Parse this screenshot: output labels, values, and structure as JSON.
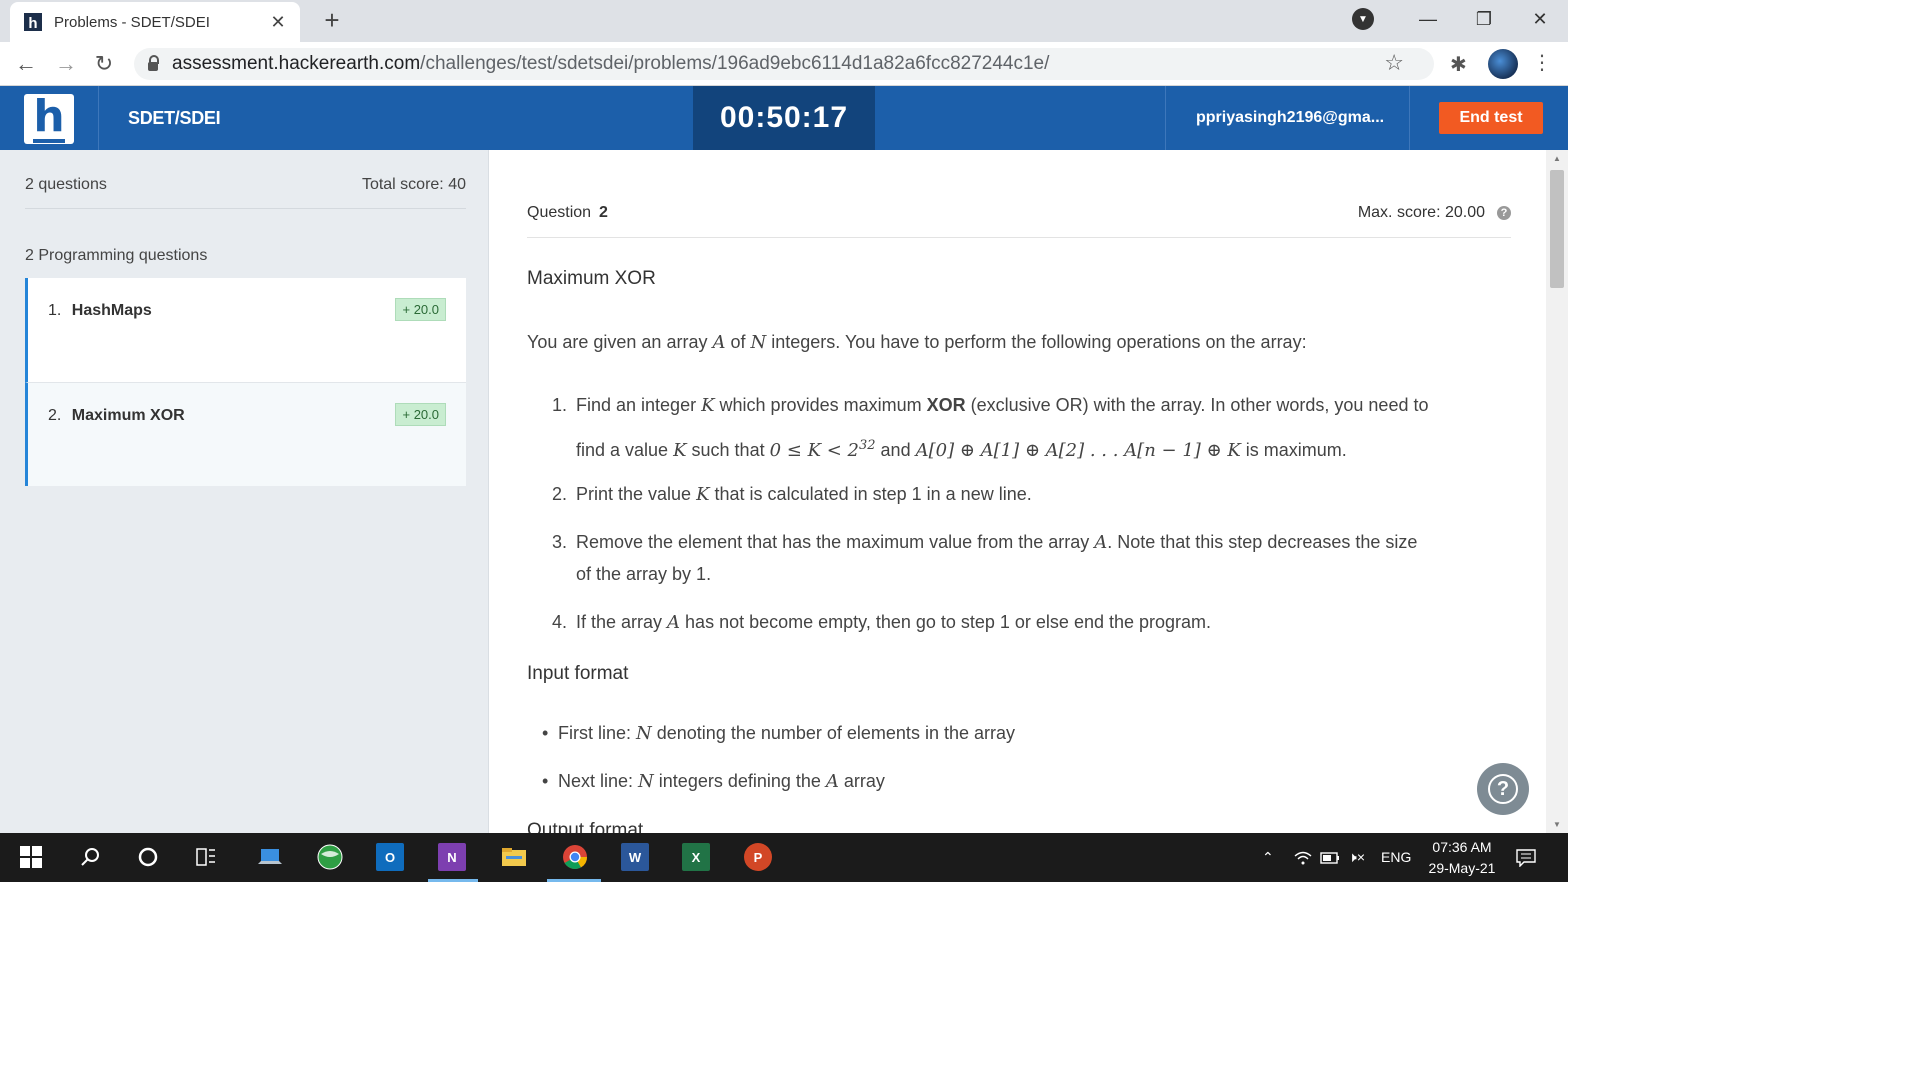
{
  "browser": {
    "tab_title": "Problems - SDET/SDEI",
    "favicon_letter": "h",
    "tab_close": "✕",
    "new_tab": "+",
    "url_host": "assessment.hackerearth.com",
    "url_path": "/challenges/test/sdetsdei/problems/196ad9ebc6114d1a82a6fcc827244c1e/",
    "back": "←",
    "forward": "→",
    "reload": "↻",
    "star": "☆",
    "extensions": "✱",
    "menu": "⋮",
    "minimize": "—",
    "restore": "❐",
    "close": "✕",
    "profile_dd": "▼"
  },
  "header": {
    "logo_letter": "h",
    "test_name": "SDET/SDEI",
    "timer": "00:50:17",
    "user_email": "ppriyasingh2196@gma...",
    "end_test": "End test"
  },
  "sidebar": {
    "question_count": "2 questions",
    "total_score": "Total score: 40",
    "section_title": "2 Programming questions",
    "questions": [
      {
        "num": "1.",
        "title": "HashMaps",
        "score": "+ 20.0"
      },
      {
        "num": "2.",
        "title": "Maximum XOR",
        "score": "+ 20.0"
      }
    ]
  },
  "problem": {
    "question_label": "Question",
    "question_number": "2",
    "max_score": "Max. score: 20.00",
    "help": "?",
    "title": "Maximum XOR",
    "intro_1": "You are given an array ",
    "intro_A": "A",
    "intro_2": " of ",
    "intro_N": "N",
    "intro_3": " integers. You have to perform the following operations on the array:",
    "step1": {
      "n": "1.",
      "a": "Find an integer ",
      "K": "K",
      "b": " which provides maximum ",
      "xor": "XOR",
      "c": " (exclusive OR) with the array. In other words, you need to",
      "d": "find a value ",
      "e": " such that ",
      "cond_lhs": "0 ≤ K < 2",
      "cond_exp": "32",
      "f": " and ",
      "expr": "A[0] ⊕ A[1] ⊕ A[2] . . . A[n − 1] ⊕ K",
      "g": " is maximum."
    },
    "step2": {
      "n": "2.",
      "a": "Print the value ",
      "K": "K",
      "b": " that is calculated in step 1 in a new line."
    },
    "step3": {
      "n": "3.",
      "a": "Remove the element that has the maximum value from the array ",
      "A": "A",
      "b": ". Note that this step decreases the size",
      "c": "of the array by 1."
    },
    "step4": {
      "n": "4.",
      "a": "If the array ",
      "A": "A",
      "b": " has not become empty, then go to step 1 or else end the program."
    },
    "input_heading": "Input format",
    "input_1a": "First line: ",
    "input_1N": "N",
    "input_1b": " denoting the number of elements in the array",
    "input_2a": "Next line: ",
    "input_2N": "N",
    "input_2b": " integers defining the ",
    "input_2A": "A",
    "input_2c": " array",
    "output_heading": "Output format"
  },
  "taskbar": {
    "time": "07:36 AM",
    "date": "29-May-21",
    "lang": "ENG"
  }
}
